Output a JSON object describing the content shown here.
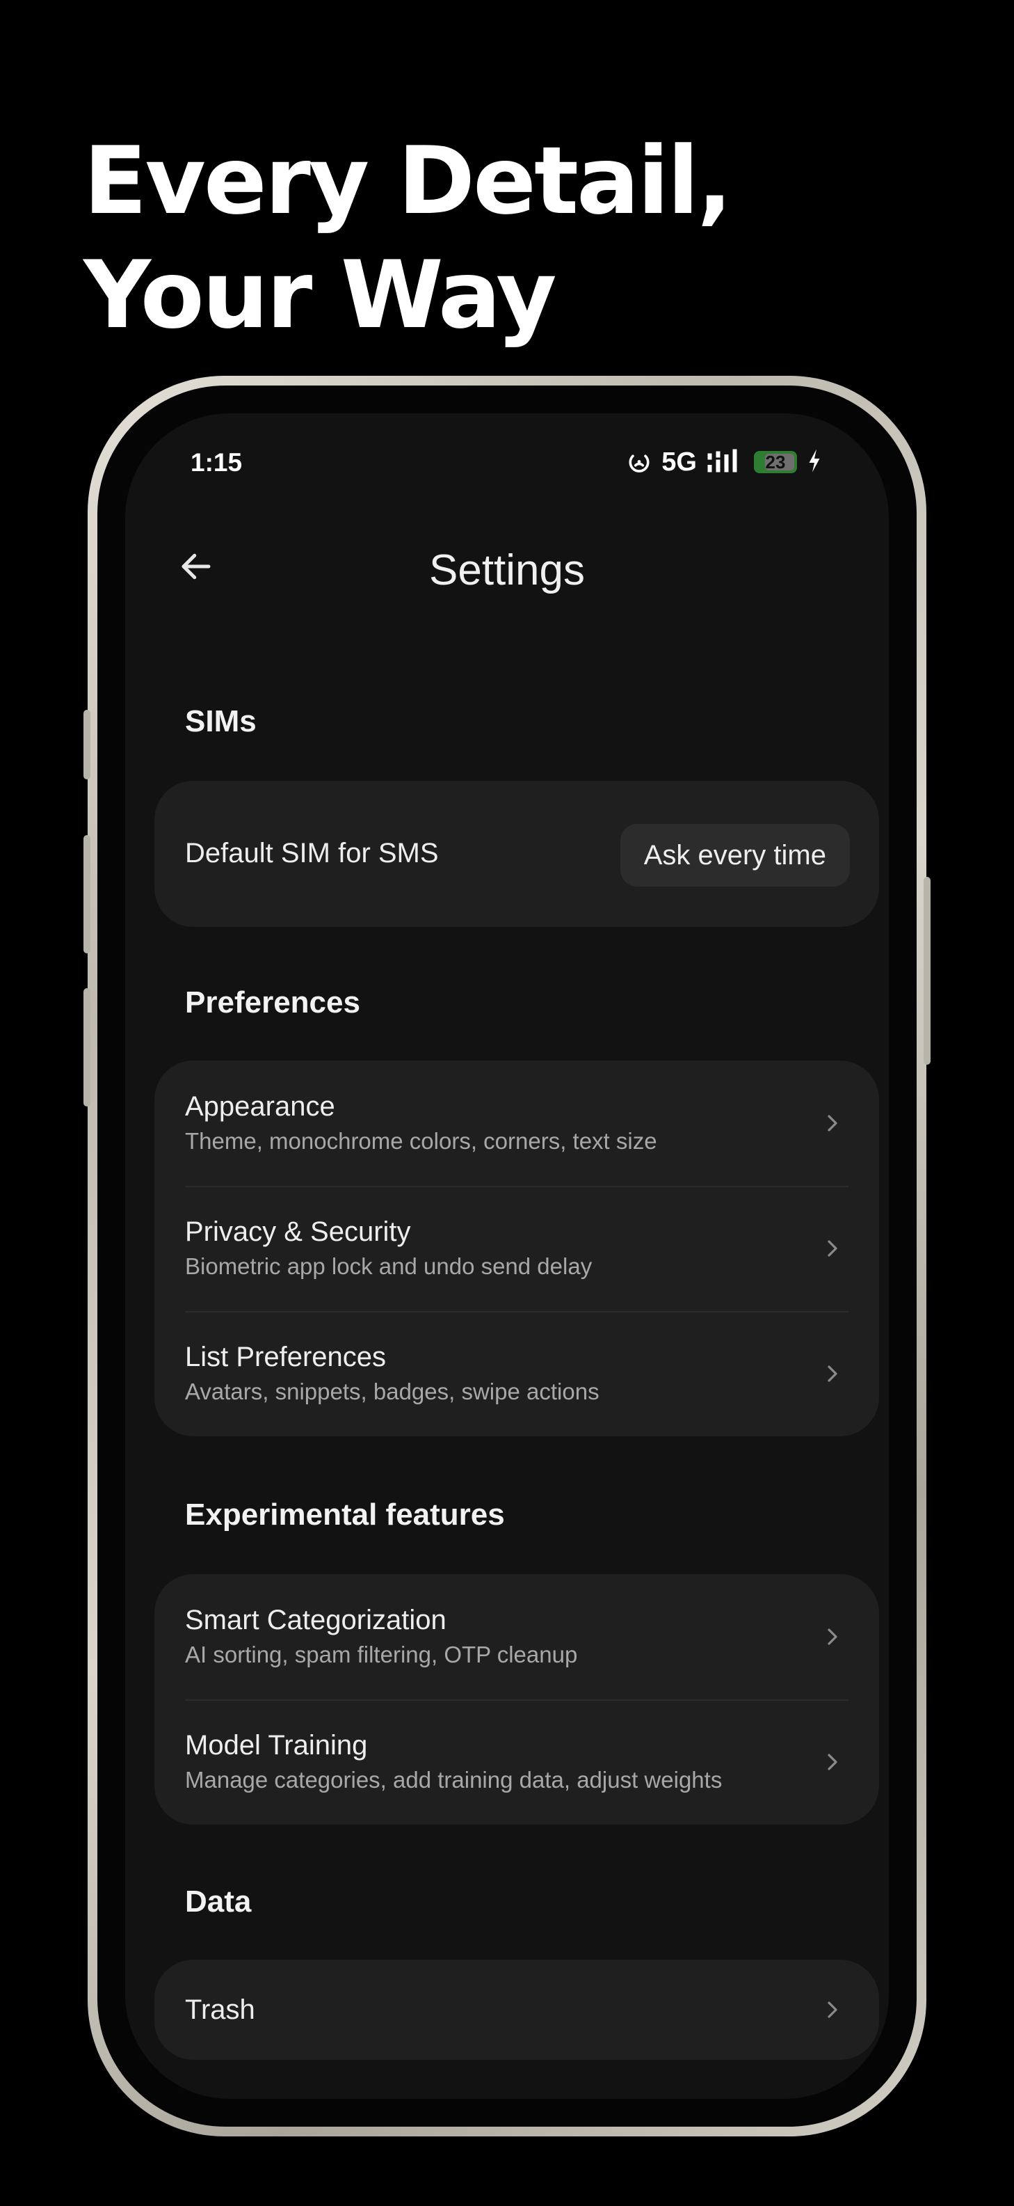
{
  "headline": {
    "line1": "Every Detail,",
    "line2": "Your Way"
  },
  "status_bar": {
    "time": "1:15",
    "network": "5G",
    "battery_level": "23",
    "icons": [
      "hotspot-icon",
      "signal-icon",
      "battery-icon",
      "charging-icon"
    ]
  },
  "app_bar": {
    "title": "Settings",
    "back_icon": "arrow-left-icon"
  },
  "sections": {
    "sims": {
      "title": "SIMs",
      "default_sim_label": "Default SIM for SMS",
      "default_sim_value": "Ask every time"
    },
    "preferences": {
      "title": "Preferences",
      "items": [
        {
          "title": "Appearance",
          "subtitle": "Theme, monochrome colors, corners, text size"
        },
        {
          "title": "Privacy & Security",
          "subtitle": "Biometric app lock and undo send delay"
        },
        {
          "title": "List Preferences",
          "subtitle": "Avatars, snippets, badges, swipe actions"
        }
      ]
    },
    "experimental": {
      "title": "Experimental features",
      "items": [
        {
          "title": "Smart Categorization",
          "subtitle": "AI sorting, spam filtering, OTP cleanup"
        },
        {
          "title": "Model Training",
          "subtitle": "Manage categories, add training data, adjust weights"
        }
      ]
    },
    "data": {
      "title": "Data",
      "items": [
        {
          "title": "Trash"
        }
      ]
    }
  },
  "colors": {
    "background": "#000000",
    "screen": "#121212",
    "card": "#1f1f1f",
    "pill": "#2c2c2c",
    "battery": "#2e7d32",
    "text_primary": "#eeeeee",
    "text_secondary": "#a8a8a8"
  }
}
